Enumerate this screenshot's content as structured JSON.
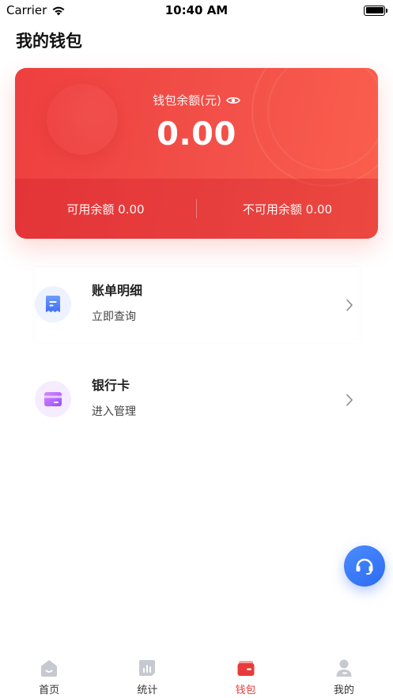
{
  "status_bar": {
    "carrier": "Carrier",
    "time": "10:40 AM"
  },
  "page": {
    "title": "我的钱包"
  },
  "wallet": {
    "balance_label": "钱包余额(元)",
    "balance": "0.00",
    "available_label": "可用余额 0.00",
    "unavailable_label": "不可用余额 0.00"
  },
  "menu": {
    "bill": {
      "title": "账单明细",
      "subtitle": "立即查询"
    },
    "bank": {
      "title": "银行卡",
      "subtitle": "进入管理"
    }
  },
  "tabs": [
    {
      "label": "首页",
      "icon": "home-icon"
    },
    {
      "label": "统计",
      "icon": "stats-icon"
    },
    {
      "label": "钱包",
      "icon": "wallet-icon"
    },
    {
      "label": "我的",
      "icon": "profile-icon"
    }
  ],
  "active_tab": "钱包",
  "colors": {
    "accent": "#e83a3a",
    "card_gradient_start": "#ee3f3f",
    "card_gradient_end": "#fb5f4d",
    "support_button": "#3a7cf8",
    "tab_inactive": "#c6c9d0"
  }
}
